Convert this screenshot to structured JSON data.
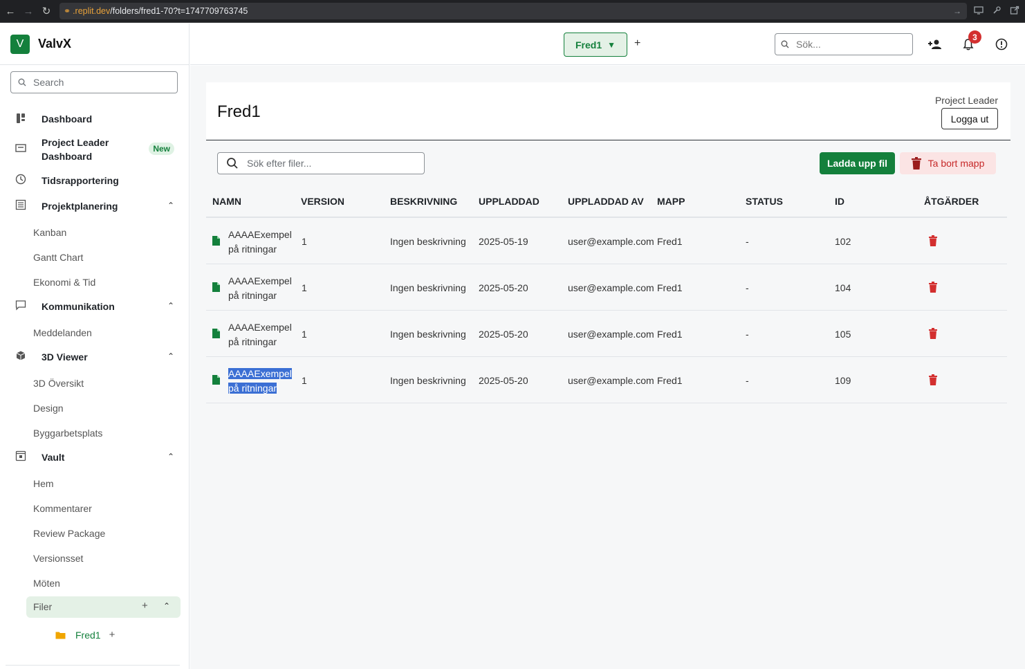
{
  "browser": {
    "url_domain": ".replit.dev",
    "url_path": "/folders/fred1-70?t=1747709763745"
  },
  "sidebar": {
    "brand_letter": "V",
    "brand_name": "ValvX",
    "search_placeholder": "Search",
    "items": [
      {
        "label": "Dashboard",
        "icon": "dashboard-icon"
      },
      {
        "label": "Project Leader Dashboard",
        "badge": "New",
        "icon": "leader-dashboard-icon"
      },
      {
        "label": "Tidsrapportering",
        "icon": "clock-icon"
      },
      {
        "label": "Projektplanering",
        "icon": "list-icon"
      },
      {
        "label": "Kommunikation",
        "icon": "chat-icon"
      },
      {
        "label": "3D Viewer",
        "icon": "cube-icon"
      },
      {
        "label": "Vault",
        "icon": "vault-icon"
      }
    ],
    "sub_planering": [
      "Kanban",
      "Gantt Chart",
      "Ekonomi & Tid"
    ],
    "sub_kommunikation": [
      "Meddelanden"
    ],
    "sub_viewer": [
      "3D Översikt",
      "Design",
      "Byggarbetsplats"
    ],
    "sub_vault": [
      "Hem",
      "Kommentarer",
      "Review Package",
      "Versionsset",
      "Möten"
    ],
    "filer_label": "Filer",
    "folder_name": "Fred1",
    "plus": "+"
  },
  "topbar": {
    "project": "Fred1",
    "add_project": "+",
    "search_placeholder": "Sök...",
    "notification_count": "3"
  },
  "main": {
    "folder_title": "Fred1",
    "role": "Project Leader",
    "logout_label": "Logga ut",
    "file_search_placeholder": "Sök efter filer...",
    "upload_label": "Ladda upp fil",
    "delete_folder_label": "Ta bort mapp"
  },
  "table": {
    "headers": [
      "NAMN",
      "VERSION",
      "BESKRIVNING",
      "UPPLADDAD",
      "UPPLADDAD AV",
      "MAPP",
      "STATUS",
      "ID",
      "ÅTGÄRDER"
    ],
    "rows": [
      {
        "name_1": "AAAAExempel",
        "name_2": "på ritningar",
        "version": "1",
        "description": "Ingen beskrivning",
        "uploaded": "2025-05-19",
        "uploaded_by": "user@example.com",
        "folder": "Fred1",
        "status": "-",
        "id": "102"
      },
      {
        "name_1": "AAAAExempel",
        "name_2": "på ritningar",
        "version": "1",
        "description": "Ingen beskrivning",
        "uploaded": "2025-05-20",
        "uploaded_by": "user@example.com",
        "folder": "Fred1",
        "status": "-",
        "id": "104"
      },
      {
        "name_1": "AAAAExempel",
        "name_2": "på ritningar",
        "version": "1",
        "description": "Ingen beskrivning",
        "uploaded": "2025-05-20",
        "uploaded_by": "user@example.com",
        "folder": "Fred1",
        "status": "-",
        "id": "105"
      },
      {
        "name_1": "AAAAExempel",
        "name_2": "på ritningar",
        "version": "1",
        "description": "Ingen beskrivning",
        "uploaded": "2025-05-20",
        "uploaded_by": "user@example.com",
        "folder": "Fred1",
        "status": "-",
        "id": "109"
      }
    ]
  },
  "colors": {
    "brand_green": "#14803c",
    "danger_red": "#c62828",
    "selection_blue": "#3b6fd4"
  }
}
